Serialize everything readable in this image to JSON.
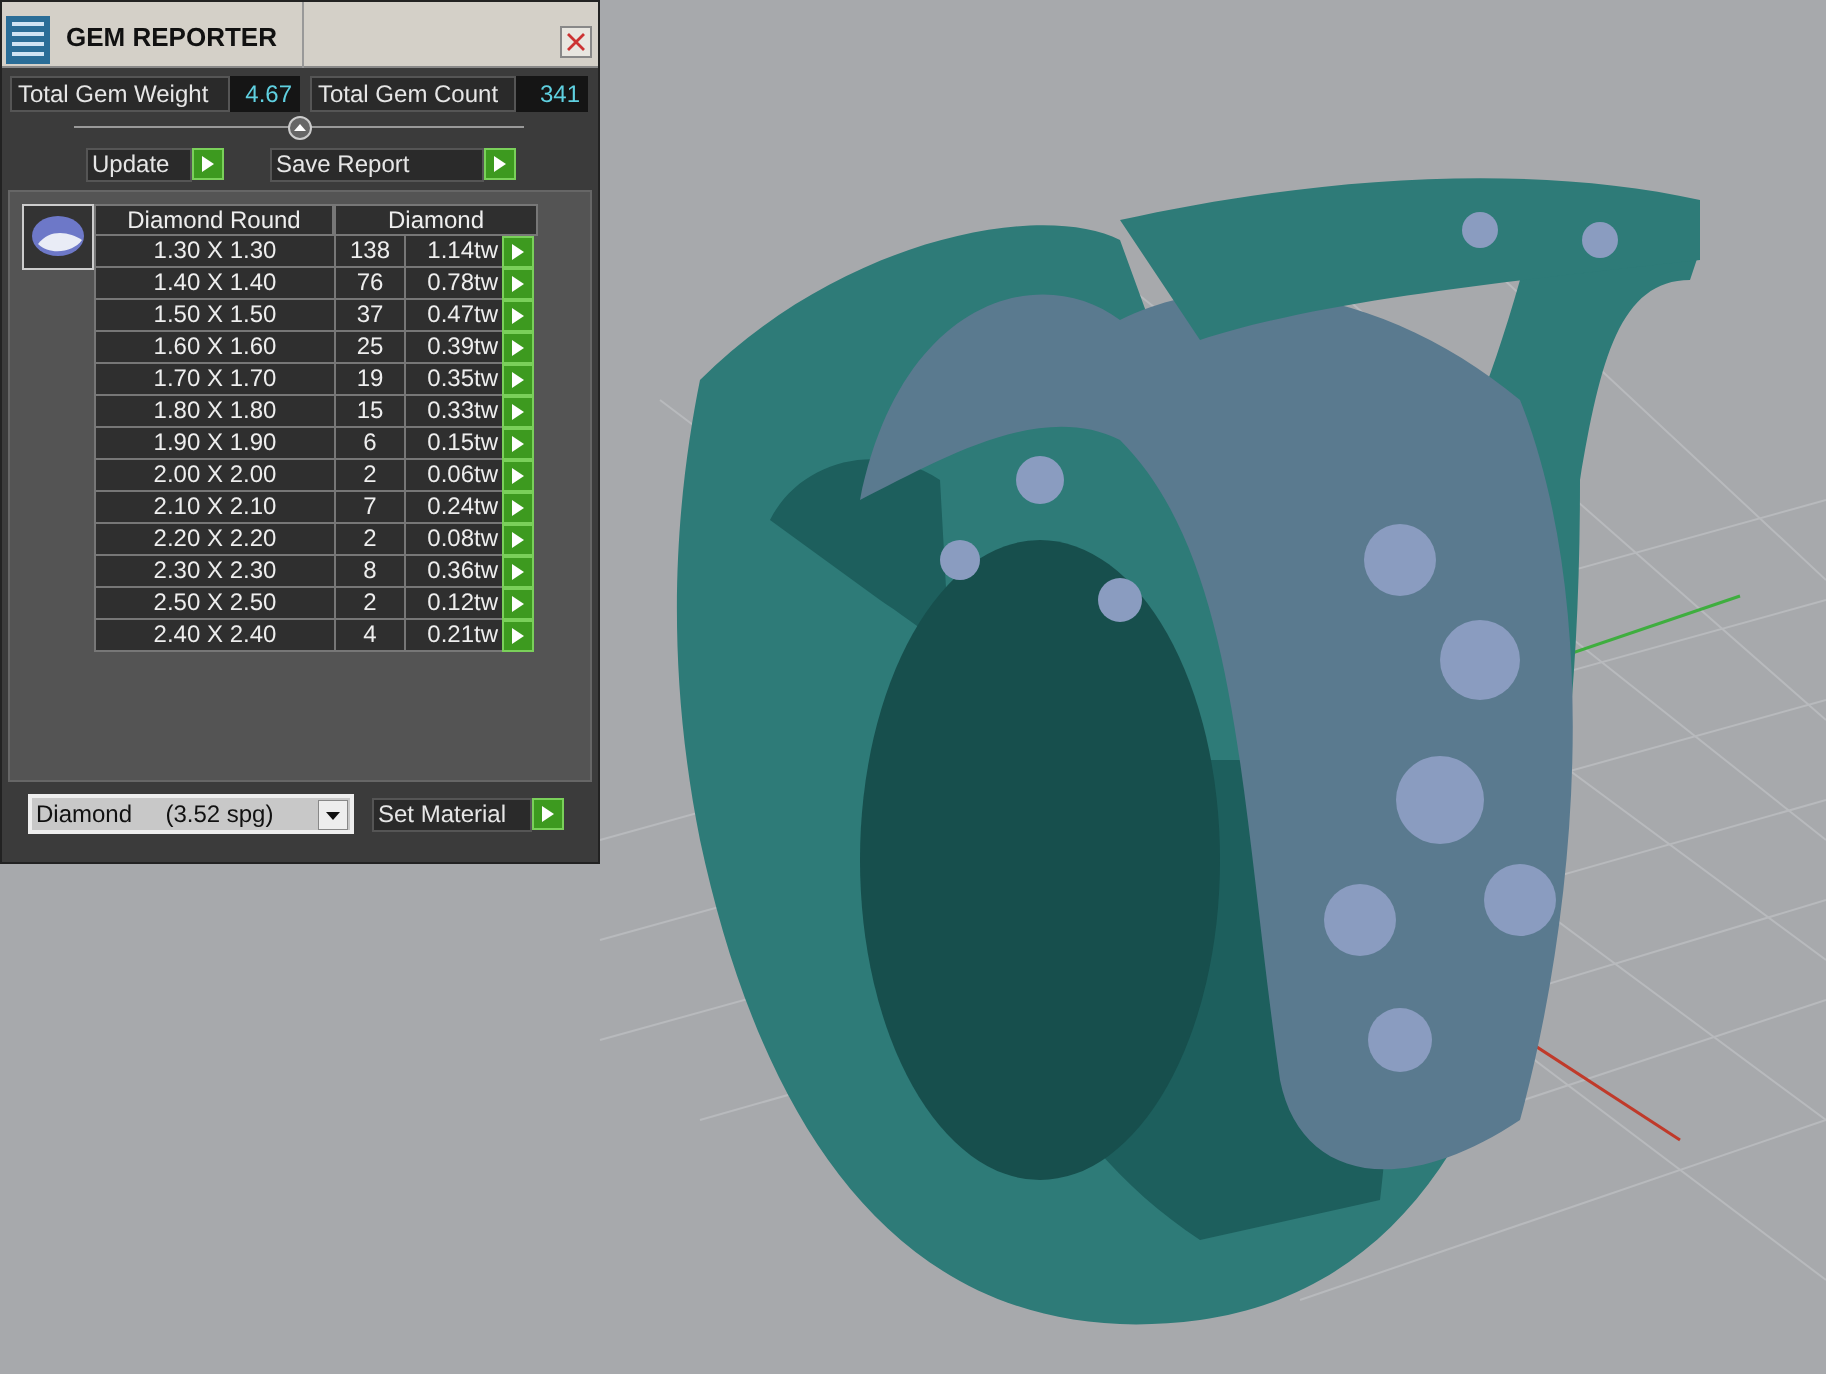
{
  "window": {
    "title": "GEM REPORTER"
  },
  "totals": [
    {
      "label": "Total Gem Weight",
      "value": "4.67"
    },
    {
      "label": "Total Gem Count",
      "value": "341"
    }
  ],
  "actions": [
    "Update",
    "Save Report"
  ],
  "table": {
    "columns": [
      "Diamond Round",
      "Diamond"
    ],
    "rows": [
      {
        "size": "1.30 X 1.30",
        "count": "138",
        "weight": "1.14tw"
      },
      {
        "size": "1.40 X 1.40",
        "count": "76",
        "weight": "0.78tw"
      },
      {
        "size": "1.50 X 1.50",
        "count": "37",
        "weight": "0.47tw"
      },
      {
        "size": "1.60 X 1.60",
        "count": "25",
        "weight": "0.39tw"
      },
      {
        "size": "1.70 X 1.70",
        "count": "19",
        "weight": "0.35tw"
      },
      {
        "size": "1.80 X 1.80",
        "count": "15",
        "weight": "0.33tw"
      },
      {
        "size": "1.90 X 1.90",
        "count": "6",
        "weight": "0.15tw"
      },
      {
        "size": "2.00 X 2.00",
        "count": "2",
        "weight": "0.06tw"
      },
      {
        "size": "2.10 X 2.10",
        "count": "7",
        "weight": "0.24tw"
      },
      {
        "size": "2.20 X 2.20",
        "count": "2",
        "weight": "0.08tw"
      },
      {
        "size": "2.30 X 2.30",
        "count": "8",
        "weight": "0.36tw"
      },
      {
        "size": "2.50 X 2.50",
        "count": "2",
        "weight": "0.12tw"
      },
      {
        "size": "2.40 X 2.40",
        "count": "4",
        "weight": "0.21tw"
      }
    ]
  },
  "material": {
    "value": "Diamond     (3.52 spg)",
    "button": "Set Material"
  }
}
